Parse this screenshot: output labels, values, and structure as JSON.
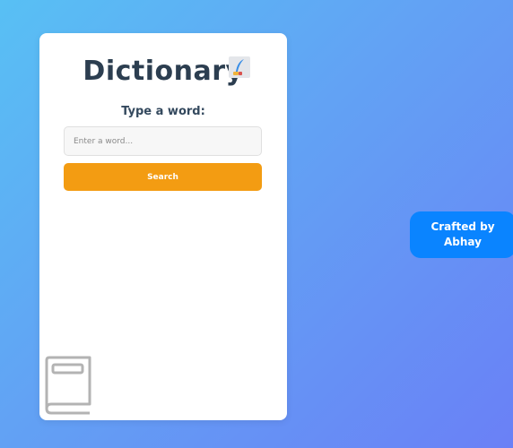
{
  "app": {
    "title": "Dictionary",
    "title_icon": "quill-pen-icon"
  },
  "form": {
    "label": "Type a word:",
    "input_placeholder": "Enter a word...",
    "input_value": "",
    "search_label": "Search"
  },
  "decoration": {
    "bottom_icon": "book-icon"
  },
  "credit": {
    "line1": "Crafted by",
    "line2": "Abhay"
  },
  "colors": {
    "background_start": "#58c0f4",
    "background_end": "#6a80f6",
    "card": "#ffffff",
    "title_text": "#2c3e50",
    "search_button": "#f39c12",
    "credit_badge": "#0a84ff"
  }
}
